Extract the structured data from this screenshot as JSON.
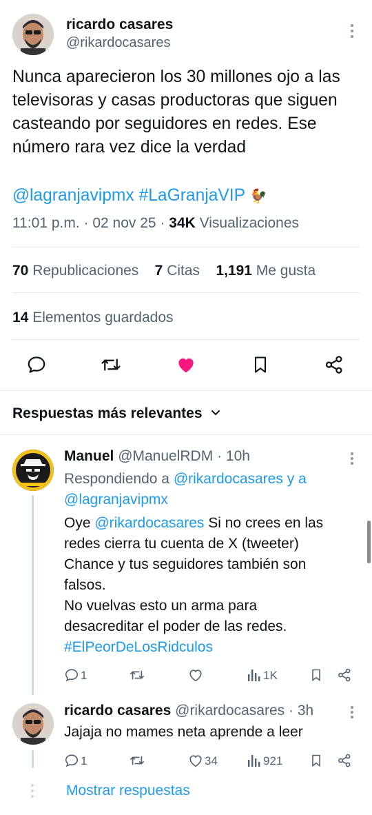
{
  "tweet": {
    "author_name": "ricardo casares",
    "author_handle": "@rikardocasares",
    "text": "Nunca aparecieron los 30 millones ojo a las televisoras y casas productoras que siguen casteando  por seguidores en redes. Ese número rara vez dice la verdad",
    "mention": "@lagranjavipmx",
    "hashtag": "#LaGranjaVIP",
    "emoji": "🐓",
    "time": "11:01 p.m.",
    "date": "02 nov 25",
    "views_count": "34K",
    "views_label": "Visualizaciones"
  },
  "stats": {
    "reposts_count": "70",
    "reposts_label": "Republicaciones",
    "quotes_count": "7",
    "quotes_label": "Citas",
    "likes_count": "1,191",
    "likes_label": "Me gusta",
    "saved_count": "14",
    "saved_label": "Elementos guardados"
  },
  "actions": {
    "icons": [
      "reply-icon",
      "repost-icon",
      "like-icon-filled",
      "bookmark-icon",
      "share-icon"
    ],
    "like_color": "#f91880"
  },
  "replies_section": {
    "title": "Respuestas más relevantes"
  },
  "replies": [
    {
      "name": "Manuel",
      "handle": "@ManuelRDM",
      "time": "· 10h",
      "replying_prefix": "Respondiendo a",
      "replying_user1": "@rikardocasares",
      "replying_and": "y a",
      "replying_user2": "@lagranjavipmx",
      "line1_prefix": "Oye",
      "line1_mention": "@rikardocasares",
      "line1_rest": "Si no crees en las",
      "line2": "redes cierra tu cuenta de X (tweeter)",
      "line3": "Chance y tus seguidores también son",
      "line4": "falsos.",
      "line5": "No vuelvas esto un arma para",
      "line6": "desacreditar el poder de las redes.",
      "line7_hashtag": "#ElPeorDeLosRidculos",
      "reply_count": "1",
      "like_count": "",
      "views": "1K"
    },
    {
      "name": "ricardo casares",
      "handle": "@rikardocasares",
      "time": "· 3h",
      "text": "Jajaja no mames neta aprende a leer",
      "reply_count": "1",
      "like_count": "34",
      "views": "921"
    }
  ],
  "show_replies": "Mostrar respuestas",
  "colors": {
    "accent": "#1d9bf0",
    "text": "#0f1419",
    "muted": "#536471",
    "divider": "#e7e9ea"
  }
}
